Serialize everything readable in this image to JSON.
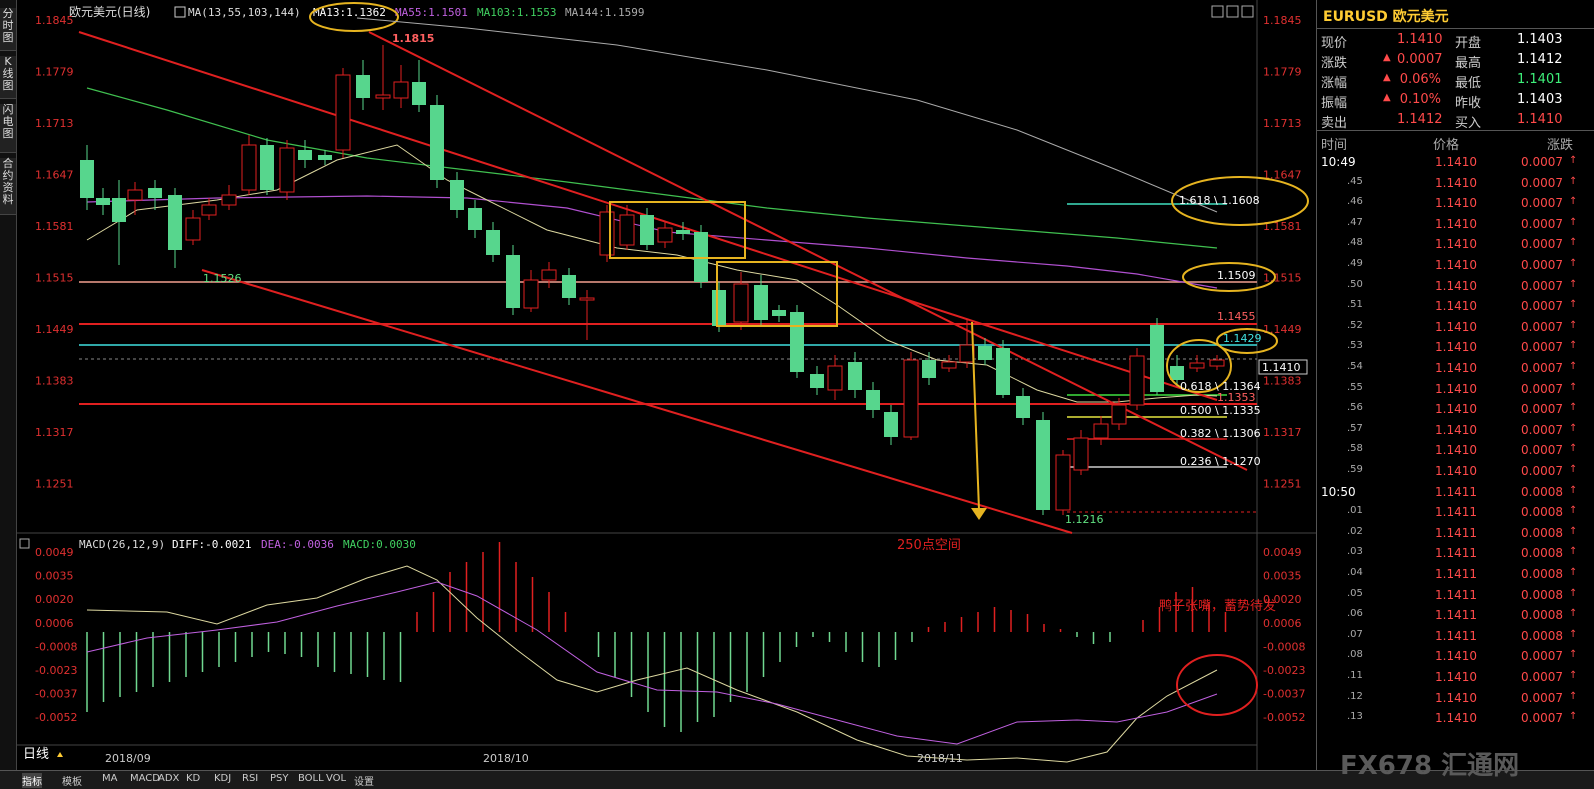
{
  "left_tabs": [
    "分时图",
    "K线图",
    "闪电图",
    "合约资料"
  ],
  "chart": {
    "title": "欧元美元(日线)",
    "ma_label": "MA(13,55,103,144)",
    "ma13": "MA13:1.1362",
    "ma55": "MA55:1.1501",
    "ma103": "MA103:1.1553",
    "ma144": "MA144:1.1599",
    "price_ticks": [
      "1.1845",
      "1.1779",
      "1.1713",
      "1.1647",
      "1.1581",
      "1.1515",
      "1.1449",
      "1.1383",
      "1.1317",
      "1.1251"
    ],
    "date_labels": [
      "2018/09",
      "2018/10",
      "2018/11"
    ],
    "annotations": {
      "high": "1.1815",
      "low1": "1.1526",
      "low2": "1.1216",
      "fib1": "1.618 \\ 1.1608",
      "fib2": "0.618 \\ 1.1364",
      "fib3": "0.500 \\ 1.1335",
      "fib4": "0.382 \\ 1.1306",
      "fib5": "0.236 \\ 1.1270",
      "lvl1509": "1.1509",
      "lvl1455": "1.1455",
      "lvl1429": "1.1429",
      "lvl1353": "1.1353",
      "current": "1.1410",
      "space": "250点空间",
      "comment": "鸭子张嘴，蓄势待发"
    },
    "macd_label": "MACD(26,12,9)",
    "diff": "DIFF:-0.0021",
    "dea": "DEA:-0.0036",
    "macd": "MACD:0.0030",
    "macd_ticks": [
      "0.0049",
      "0.0035",
      "0.0020",
      "0.0006",
      "-0.0008",
      "-0.0023",
      "-0.0037",
      "-0.0052"
    ],
    "period": "日线"
  },
  "quote": {
    "symbol": "EURUSD 欧元美元",
    "rows": [
      {
        "l1": "现价",
        "v1": "1.1410",
        "l2": "开盘",
        "v2": "1.1403"
      },
      {
        "l1": "涨跌",
        "v1": "0.0007",
        "l2": "最高",
        "v2": "1.1412"
      },
      {
        "l1": "涨幅",
        "v1": "0.06%",
        "l2": "最低",
        "v2": "1.1401"
      },
      {
        "l1": "振幅",
        "v1": "0.10%",
        "l2": "昨收",
        "v2": "1.1403"
      },
      {
        "l1": "卖出",
        "v1": "1.1412",
        "l2": "买入",
        "v2": "1.1410"
      }
    ],
    "tick_header": [
      "时间",
      "价格",
      "涨跌"
    ],
    "ticks": [
      [
        "10:49",
        "1.1410",
        "0.0007"
      ],
      [
        ".45",
        "1.1410",
        "0.0007"
      ],
      [
        ".46",
        "1.1410",
        "0.0007"
      ],
      [
        ".47",
        "1.1410",
        "0.0007"
      ],
      [
        ".48",
        "1.1410",
        "0.0007"
      ],
      [
        ".49",
        "1.1410",
        "0.0007"
      ],
      [
        ".50",
        "1.1410",
        "0.0007"
      ],
      [
        ".51",
        "1.1410",
        "0.0007"
      ],
      [
        ".52",
        "1.1410",
        "0.0007"
      ],
      [
        ".53",
        "1.1410",
        "0.0007"
      ],
      [
        ".54",
        "1.1410",
        "0.0007"
      ],
      [
        ".55",
        "1.1410",
        "0.0007"
      ],
      [
        ".56",
        "1.1410",
        "0.0007"
      ],
      [
        ".57",
        "1.1410",
        "0.0007"
      ],
      [
        ".58",
        "1.1410",
        "0.0007"
      ],
      [
        ".59",
        "1.1410",
        "0.0007"
      ],
      [
        "10:50",
        "1.1411",
        "0.0008"
      ],
      [
        ".01",
        "1.1411",
        "0.0008"
      ],
      [
        ".02",
        "1.1411",
        "0.0008"
      ],
      [
        ".03",
        "1.1411",
        "0.0008"
      ],
      [
        ".04",
        "1.1411",
        "0.0008"
      ],
      [
        ".05",
        "1.1411",
        "0.0008"
      ],
      [
        ".06",
        "1.1411",
        "0.0008"
      ],
      [
        ".07",
        "1.1411",
        "0.0008"
      ],
      [
        ".08",
        "1.1410",
        "0.0007"
      ],
      [
        ".11",
        "1.1410",
        "0.0007"
      ],
      [
        ".12",
        "1.1410",
        "0.0007"
      ],
      [
        ".13",
        "1.1410",
        "0.0007"
      ]
    ]
  },
  "bottom_tabs": [
    "指标",
    "模板",
    "MA",
    "MACD",
    "ADX",
    "KD",
    "KDJ",
    "RSI",
    "PSY",
    "BOLL",
    "VOL",
    "设置"
  ],
  "watermark": "FX678 汇通网",
  "colors": {
    "up": "#ff4a4a",
    "down": "#3ef07a",
    "candle_green": "#57d68d",
    "channel": "#e02020",
    "fib_yellow": "#e6b420"
  }
}
